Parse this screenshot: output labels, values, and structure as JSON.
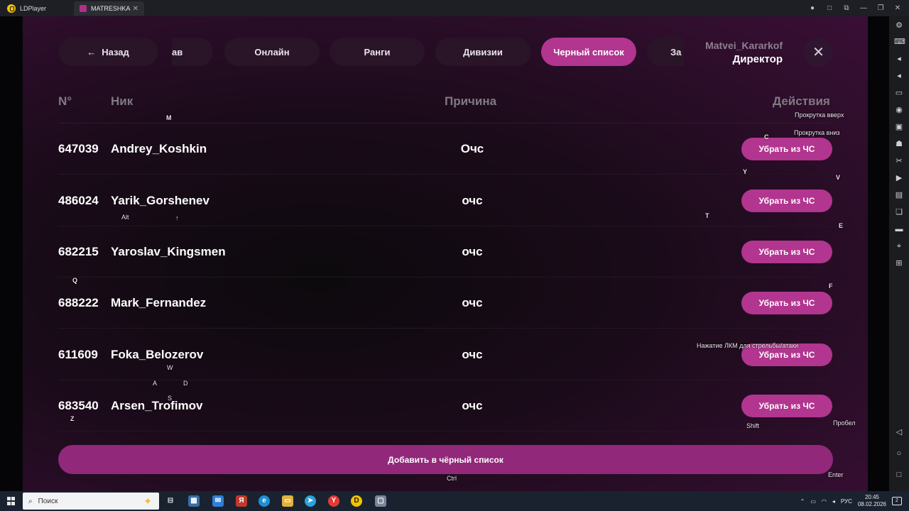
{
  "titlebar": {
    "app_name": "LDPlayer",
    "tab_title": "MATRESHKA",
    "tab_close": "✕",
    "controls": [
      "●",
      "□",
      "⧉",
      "—",
      "❐",
      "✕"
    ]
  },
  "nav": {
    "back_label": "Назад",
    "back_arrow": "←",
    "tabs": [
      {
        "label": "ав",
        "state": "partial"
      },
      {
        "label": "Онлайн",
        "state": "normal"
      },
      {
        "label": "Ранги",
        "state": "normal"
      },
      {
        "label": "Дивизии",
        "state": "normal"
      },
      {
        "label": "Черный список",
        "state": "active"
      },
      {
        "label": "За",
        "state": "partial"
      }
    ]
  },
  "user": {
    "name": "Matvei_Kararkof",
    "role": "Директор",
    "close_glyph": "✕"
  },
  "table": {
    "headers": {
      "id": "N°",
      "nick": "Ник",
      "reason": "Причина",
      "actions": "Действия"
    },
    "rows": [
      {
        "id": "647039",
        "nick": "Andrey_Koshkin",
        "reason": "Очс",
        "action": "Убрать из ЧС"
      },
      {
        "id": "486024",
        "nick": "Yarik_Gorshenev",
        "reason": "очс",
        "action": "Убрать из ЧС"
      },
      {
        "id": "682215",
        "nick": "Yaroslav_Kingsmen",
        "reason": "очс",
        "action": "Убрать из ЧС"
      },
      {
        "id": "688222",
        "nick": "Mark_Fernandez",
        "reason": "очс",
        "action": "Убрать из ЧС"
      },
      {
        "id": "611609",
        "nick": "Foka_Belozerov",
        "reason": "очс",
        "action": "Убрать из ЧС"
      },
      {
        "id": "683540",
        "nick": "Arsen_Trofimov",
        "reason": "очс",
        "action": "Убрать из ЧС"
      }
    ]
  },
  "add_button": "Добавить в чёрный список",
  "keymap": {
    "m": "M",
    "scroll_up": "Прокрутка вверх",
    "scroll_down": "Прокрутка вниз",
    "c": "C",
    "y": "Y",
    "v": "V",
    "alt": "Alt",
    "up": "↑",
    "t": "T",
    "e": "E",
    "q": "Q",
    "f": "F",
    "lmb": "Нажатие ЛКМ для стрельбы/атаки",
    "w": "W",
    "a": "A",
    "d": "D",
    "s": "S",
    "z": "Z",
    "shift": "Shift",
    "space": "Пробел",
    "enter": "Enter",
    "ctrl": "Ctrl"
  },
  "taskbar": {
    "search_placeholder": "Поиск",
    "language": "РУС",
    "time": "20:45",
    "date": "08.02.2026",
    "notifications": "2"
  },
  "colors": {
    "accent": "#b2358f",
    "pill_bg": "#2a1528",
    "add_button": "#92287a"
  }
}
